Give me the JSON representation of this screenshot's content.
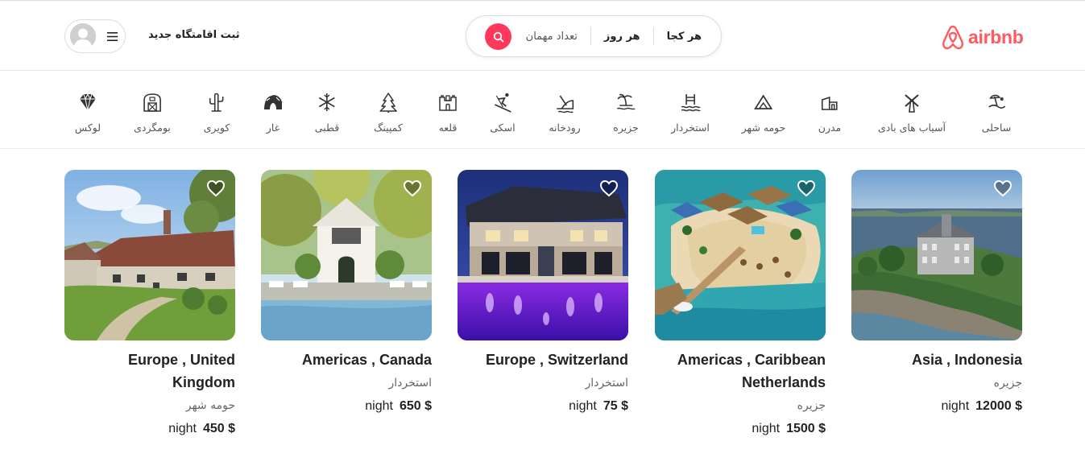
{
  "header": {
    "brand": "airbnb",
    "search": {
      "where": "هر کجا",
      "when": "هر روز",
      "guests": "تعداد مهمان"
    },
    "host_link": "ثبت اقامتگاه جدید"
  },
  "categories": [
    {
      "label": "ساحلی",
      "icon": "beach-icon"
    },
    {
      "label": "آسیاب های بادی",
      "icon": "windmill-icon"
    },
    {
      "label": "مدرن",
      "icon": "modern-house-icon"
    },
    {
      "label": "حومه شهر",
      "icon": "countryside-icon"
    },
    {
      "label": "استخردار",
      "icon": "pool-icon"
    },
    {
      "label": "جزیره",
      "icon": "island-icon"
    },
    {
      "label": "رودخانه",
      "icon": "river-icon"
    },
    {
      "label": "اسکی",
      "icon": "ski-icon"
    },
    {
      "label": "قلعه",
      "icon": "castle-icon"
    },
    {
      "label": "کمپینگ",
      "icon": "camping-icon"
    },
    {
      "label": "قطبی",
      "icon": "snowflake-icon"
    },
    {
      "label": "غار",
      "icon": "cave-icon"
    },
    {
      "label": "کویری",
      "icon": "cactus-icon"
    },
    {
      "label": "بومگردی",
      "icon": "barn-icon"
    },
    {
      "label": "لوکس",
      "icon": "diamond-icon"
    }
  ],
  "listings": [
    {
      "location": "Asia , Indonesia",
      "type": "جزیره",
      "price": "12000 $",
      "unit": "night",
      "image": "mansion-on-coast-photo"
    },
    {
      "location": "Americas , Caribbean Netherlands",
      "type": "جزیره",
      "price": "1500 $",
      "unit": "night",
      "image": "island-resort-photo"
    },
    {
      "location": "Europe , Switzerland",
      "type": "استخردار",
      "price": "75 $",
      "unit": "night",
      "image": "villa-purple-pool-photo"
    },
    {
      "location": "Americas , Canada",
      "type": "استخردار",
      "price": "650 $",
      "unit": "night",
      "image": "house-with-pool-photo"
    },
    {
      "location": "Europe , United Kingdom",
      "type": "حومه شهر",
      "price": "450 $",
      "unit": "night",
      "image": "stone-cottage-photo"
    }
  ],
  "colors": {
    "brand": "#ff5a5f",
    "search_button": "#ff385c"
  }
}
